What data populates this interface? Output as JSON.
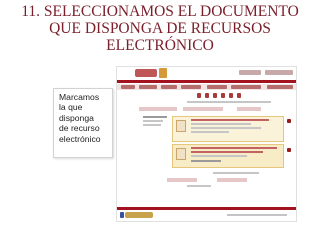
{
  "slide": {
    "title_line1": "11. SELECCIONAMOS EL DOCUMENTO",
    "title_line2": "QUE DISPONGA DE RECURSOS",
    "title_line3": "ELECTRÓNICO"
  },
  "callout": {
    "line1": "Marcamos",
    "line2": "la que",
    "line3": "disponga",
    "line4": "de recurso",
    "line5": "electrónico"
  },
  "colors": {
    "title": "#7a1f2b",
    "brand_red": "#a4121f",
    "nav_bg": "#f0e4e4",
    "highlight": "#f1dc96"
  },
  "screenshot": {
    "icons": [
      "logo-icon",
      "menu-icon",
      "folder-icon",
      "print-icon",
      "mail-icon",
      "star-icon"
    ]
  }
}
